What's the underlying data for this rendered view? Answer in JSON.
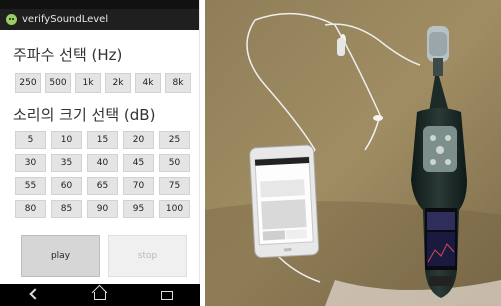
{
  "app": {
    "title": "verifySoundLevel"
  },
  "freq_section": {
    "label": "주파수 선택 (Hz)",
    "buttons": [
      "250",
      "500",
      "1k",
      "2k",
      "4k",
      "8k"
    ]
  },
  "level_section": {
    "label": "소리의 크기 선택 (dB)",
    "buttons": [
      "5",
      "10",
      "15",
      "20",
      "25",
      "30",
      "35",
      "40",
      "45",
      "50",
      "55",
      "60",
      "65",
      "70",
      "75",
      "80",
      "85",
      "90",
      "95",
      "100"
    ]
  },
  "controls": {
    "play": "play",
    "stop": "stop"
  },
  "icons": {
    "app": "android-icon",
    "back": "back-icon",
    "home": "home-icon",
    "recent": "recent-apps-icon"
  },
  "colors": {
    "titlebar": "#1f1f1f",
    "button": "#e4e4e4",
    "stop_text": "#b8b8b8"
  }
}
